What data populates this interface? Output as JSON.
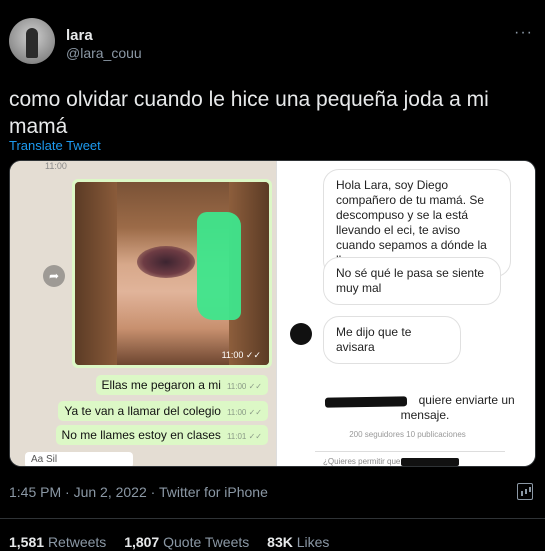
{
  "author": {
    "name": "lara",
    "handle": "@lara_couu"
  },
  "more_label": "···",
  "tweet": {
    "text": "como olvidar cuando le hice una pequeña joda a mi mamá",
    "translate": "Translate Tweet",
    "timestamp": "1:45 PM · Jun 2, 2022 · Twitter for iPhone"
  },
  "chat": {
    "top_time": "11:00",
    "photo_time": "11:00 ✓✓",
    "messages": [
      {
        "text": "Ellas me pegaron a mi",
        "time": "11:00 ✓✓"
      },
      {
        "text": "Ya te van a llamar del colegio",
        "time": "11:00 ✓✓"
      },
      {
        "text": "No me llames estoy en clases",
        "time": "11:01 ✓✓"
      }
    ],
    "incoming_partial": "Aa Sil"
  },
  "instagram": {
    "messages": [
      "Hola Lara, soy Diego compañero de tu mamá. Se descompuso y se la está llevando el eci, te aviso cuando sepamos a dónde la llevan",
      "No sé qué le pasa se siente muy mal",
      "Me dijo que te avisara"
    ],
    "request": "quiere enviarte un mensaje.",
    "stats": "200 seguidores 10 publicaciones",
    "bottom": "¿Quieres permitir que                te envíe"
  },
  "stats": {
    "retweets_count": "1,581",
    "retweets_label": "Retweets",
    "quotes_count": "1,807",
    "quotes_label": "Quote Tweets",
    "likes_count": "83K",
    "likes_label": "Likes"
  }
}
